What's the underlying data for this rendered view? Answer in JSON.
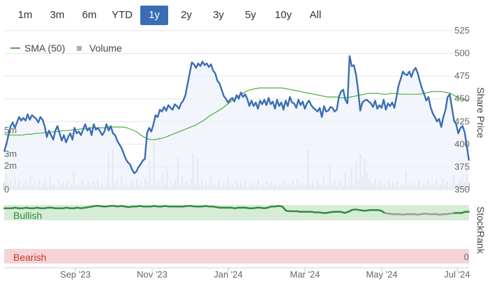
{
  "range_selector": {
    "buttons": [
      "1m",
      "3m",
      "6m",
      "YTD",
      "1y",
      "2y",
      "3y",
      "5y",
      "10y",
      "All"
    ],
    "active": "1y"
  },
  "colors": {
    "price_line": "#3a6db5",
    "price_fill": "#eef3fb",
    "sma_line": "#4cae3c",
    "volume_bar": "#c9c9c9",
    "stockrank_line": "#2f8a3a",
    "stockrank_line_low": "#9a9a9a",
    "bullish_band": "#d6ecd6",
    "bearish_band": "#f6d4d6",
    "bullish_text": "#2f8a3a",
    "bearish_text": "#c0392b",
    "active_button": "#3a6db5"
  },
  "chart_data": {
    "type": "line",
    "x_labels": [
      "Sep '23",
      "Nov '23",
      "Jan '24",
      "Mar '24",
      "May '24",
      "Jul '24"
    ],
    "right_axis_title": "Share Price",
    "y_ticks": [
      350,
      375,
      400,
      425,
      450,
      475,
      500,
      525
    ],
    "ylim": [
      350,
      525
    ],
    "volume_ticks": [
      "0",
      "2m",
      "3m",
      "5m"
    ],
    "volume_max": 6,
    "legend": [
      {
        "name": "SMA (50)",
        "icon": "line"
      },
      {
        "name": "Volume",
        "icon": "square"
      }
    ],
    "price": [
      392,
      400,
      410,
      420,
      424,
      418,
      424,
      430,
      426,
      429,
      426,
      433,
      427,
      432,
      430,
      428,
      424,
      430,
      427,
      420,
      408,
      415,
      410,
      405,
      415,
      420,
      412,
      404,
      410,
      402,
      408,
      412,
      405,
      418,
      412,
      414,
      410,
      416,
      422,
      415,
      418,
      410,
      422,
      416,
      418,
      414,
      410,
      414,
      422,
      415,
      420,
      412,
      410,
      404,
      400,
      396,
      390,
      384,
      380,
      378,
      372,
      368,
      370,
      375,
      378,
      382,
      384,
      412,
      418,
      414,
      422,
      432,
      430,
      438,
      436,
      441,
      437,
      443,
      440,
      438,
      444,
      442,
      439,
      445,
      448,
      454,
      466,
      478,
      490,
      488,
      484,
      489,
      486,
      491,
      487,
      489,
      485,
      488,
      481,
      478,
      470,
      467,
      460,
      453,
      450,
      446,
      449,
      451,
      447,
      454,
      450,
      457,
      452,
      455,
      450,
      442,
      448,
      442,
      446,
      439,
      448,
      444,
      449,
      443,
      451,
      444,
      447,
      439,
      449,
      442,
      446,
      438,
      448,
      442,
      452,
      446,
      445,
      440,
      449,
      443,
      447,
      439,
      445,
      448,
      443,
      440,
      438,
      436,
      440,
      430,
      442,
      436,
      437,
      441,
      440,
      436,
      438,
      452,
      458,
      460,
      449,
      445,
      497,
      486,
      487,
      477,
      460,
      437,
      446,
      448,
      449,
      447,
      445,
      441,
      448,
      439,
      443,
      440,
      449,
      438,
      445,
      442,
      446,
      440,
      452,
      465,
      472,
      480,
      477,
      476,
      480,
      474,
      481,
      484,
      478,
      469,
      461,
      455,
      448,
      452,
      441,
      434,
      430,
      425,
      428,
      419,
      430,
      438,
      452,
      455,
      440,
      426,
      422,
      412,
      418,
      420,
      413,
      398,
      382
    ],
    "sma50": [
      411,
      410,
      410,
      410,
      410,
      411,
      411,
      412,
      412,
      413,
      413,
      414,
      414,
      415,
      415,
      416,
      416,
      417,
      417,
      418,
      418,
      418,
      418,
      419,
      419,
      419,
      419,
      418,
      416,
      414,
      410,
      407,
      405,
      405,
      406,
      407,
      409,
      411,
      413,
      415,
      417,
      419,
      421,
      424,
      427,
      431,
      434,
      437,
      440,
      444,
      448,
      452,
      455,
      458,
      460,
      461,
      462,
      462,
      462,
      462,
      462,
      462,
      461,
      460,
      459,
      458,
      457,
      456,
      455,
      454,
      453,
      452,
      452,
      452,
      451,
      451,
      452,
      453,
      454,
      455,
      456,
      456,
      456,
      455,
      455,
      456,
      456,
      455,
      455,
      455,
      455,
      455,
      456,
      457,
      458,
      458,
      458,
      457,
      456,
      453,
      450,
      449,
      448
    ],
    "volume": [
      0.6,
      1.4,
      0.5,
      0.9,
      0.3,
      1.0,
      0.4,
      0.8,
      0.3,
      0.5,
      0.9,
      0.3,
      1.2,
      0.4,
      0.6,
      0.3,
      0.8,
      0.2,
      0.5,
      1.0,
      0.3,
      1.1,
      0.4,
      0.5,
      0.2,
      0.9,
      0.4,
      0.6,
      0.3,
      0.7,
      0.2,
      0.4,
      1.6,
      0.3,
      0.5,
      0.3,
      0.8,
      0.2,
      0.4,
      0.6,
      0.3,
      0.7,
      0.4,
      0.9,
      0.3,
      0.5,
      0.2,
      0.6,
      3.2,
      0.4,
      3.4,
      0.5,
      0.9,
      0.3,
      1.2,
      0.4,
      0.6,
      0.3,
      0.5,
      0.8,
      0.3,
      0.9,
      0.4,
      0.7,
      0.3,
      1.0,
      0.6,
      2.5,
      0.4,
      4.2,
      0.5,
      0.8,
      0.3,
      1.4,
      0.5,
      1.9,
      0.3,
      0.6,
      0.4,
      0.9,
      2.7,
      0.4,
      1.2,
      0.3,
      0.7,
      0.4,
      0.9,
      3.0,
      0.5,
      2.6,
      0.4,
      0.8,
      0.3,
      0.6,
      0.3,
      1.1,
      0.4,
      0.5,
      0.3,
      0.9,
      0.2,
      0.6,
      0.4,
      1.0,
      0.3,
      0.5,
      0.2,
      0.7,
      0.4,
      0.6,
      0.3,
      0.8,
      0.2,
      0.5,
      0.4,
      0.6,
      0.3,
      0.9,
      0.2,
      0.5,
      0.3,
      0.7,
      0.4,
      0.6,
      0.3,
      0.5,
      0.2,
      0.6,
      0.4,
      0.8,
      0.3,
      0.5,
      0.4,
      0.7,
      0.3,
      0.9,
      0.4,
      0.6,
      0.3,
      0.5,
      3.4,
      0.4,
      0.6,
      0.3,
      0.8,
      0.5,
      0.4,
      1.2,
      0.3,
      0.6,
      2.1,
      0.4,
      0.9,
      0.3,
      0.5,
      0.7,
      0.4,
      1.5,
      0.3,
      0.6,
      1.8,
      0.5,
      2.4,
      0.8,
      3.0,
      1.1,
      2.6,
      1.4,
      0.9,
      0.6,
      0.4,
      1.0,
      0.3,
      0.7,
      0.4,
      0.5,
      0.3,
      0.8,
      0.4,
      0.6,
      0.3,
      0.7,
      0.2,
      0.5,
      0.4,
      1.6,
      0.3,
      0.5,
      0.4,
      0.6,
      0.3,
      0.9,
      0.3,
      0.5,
      0.4,
      0.8,
      0.3,
      0.6,
      0.4,
      0.9,
      0.3,
      0.5,
      1.0,
      0.4,
      0.7,
      0.3,
      0.6,
      1.2,
      0.4,
      0.6,
      0.9,
      1.1,
      0.7,
      1.3,
      0.6
    ],
    "stockrank": {
      "labels": [
        "Bullish",
        "Bearish"
      ],
      "right_axis_title": "StockRank",
      "y_tick": "0",
      "scale": [
        0,
        100
      ],
      "values": [
        92,
        92,
        92,
        93,
        92,
        92,
        93,
        92,
        92,
        93,
        92,
        92,
        93,
        93,
        92,
        92,
        92,
        93,
        92,
        92,
        93,
        92,
        93,
        94,
        95,
        96,
        96,
        95,
        95,
        96,
        96,
        95,
        96,
        95,
        94,
        95,
        95,
        96,
        95,
        95,
        95,
        96,
        95,
        95,
        96,
        95,
        95,
        95,
        95,
        95,
        96,
        96,
        95,
        95,
        95,
        96,
        95,
        95,
        94,
        93,
        93,
        93,
        93,
        92,
        93,
        93,
        93,
        92,
        92,
        93,
        93,
        92,
        93,
        95,
        95,
        96,
        95,
        88,
        87,
        87,
        87,
        86,
        86,
        86,
        86,
        85,
        85,
        84,
        84,
        85,
        86,
        86,
        86,
        84,
        86,
        89,
        90,
        89,
        88,
        88,
        89,
        89,
        89,
        88,
        84,
        83,
        82,
        82,
        82,
        81,
        82,
        82,
        82,
        81,
        82,
        83,
        82,
        82,
        82,
        81,
        82,
        82,
        83,
        84,
        84,
        84,
        86,
        86
      ],
      "low_threshold": 84
    }
  }
}
